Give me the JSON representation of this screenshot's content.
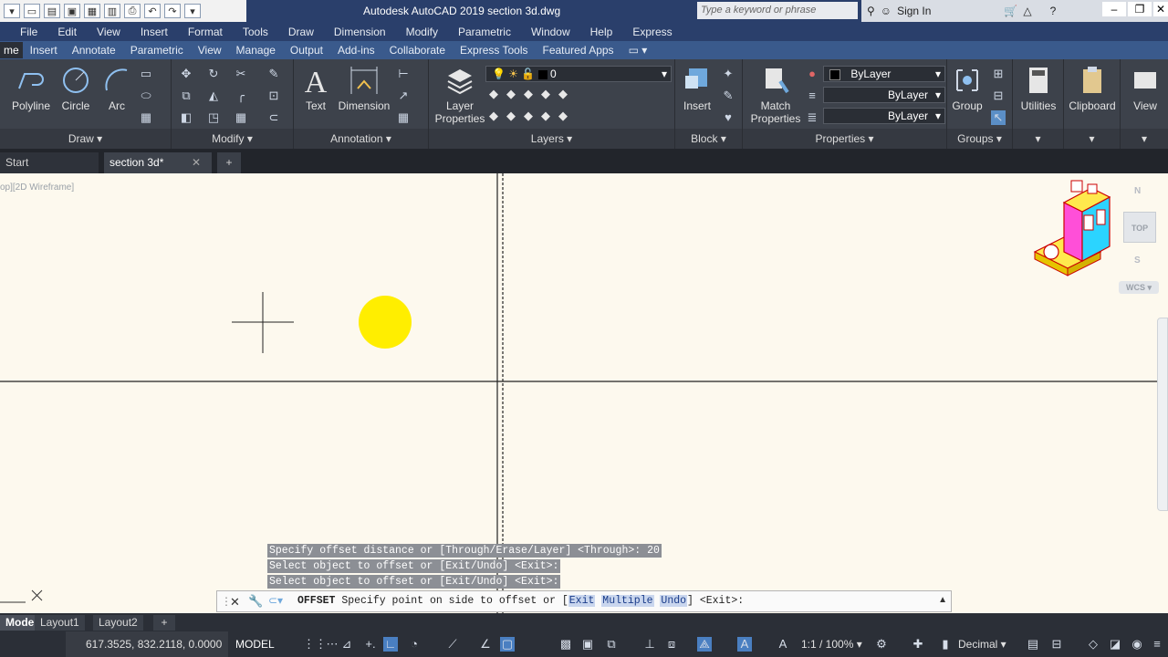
{
  "window": {
    "title": "Autodesk AutoCAD 2019    section 3d.dwg",
    "search_placeholder": "Type a keyword or phrase",
    "sign_in": "Sign In"
  },
  "menu": [
    "File",
    "Edit",
    "View",
    "Insert",
    "Format",
    "Tools",
    "Draw",
    "Dimension",
    "Modify",
    "Parametric",
    "Window",
    "Help",
    "Express"
  ],
  "ribbon_tabs": [
    "me",
    "Insert",
    "Annotate",
    "Parametric",
    "View",
    "Manage",
    "Output",
    "Add-ins",
    "Collaborate",
    "Express Tools",
    "Featured Apps"
  ],
  "ribbon": {
    "draw": {
      "title": "Draw",
      "polyline": "Polyline",
      "circle": "Circle",
      "arc": "Arc"
    },
    "modify": {
      "title": "Modify"
    },
    "annotation": {
      "title": "Annotation",
      "text": "Text",
      "dimension": "Dimension"
    },
    "layers": {
      "title": "Layers",
      "layer_properties_1": "Layer",
      "layer_properties_2": "Properties",
      "current_layer": "0"
    },
    "block": {
      "title": "Block",
      "insert": "Insert"
    },
    "properties": {
      "title": "Properties",
      "match_1": "Match",
      "match_2": "Properties",
      "color": "ByLayer",
      "linetype": "ByLayer",
      "lineweight": "ByLayer"
    },
    "groups": {
      "title": "Groups",
      "group": "Group"
    },
    "utilities": "Utilities",
    "clipboard": "Clipboard",
    "view": "View"
  },
  "file_tabs": {
    "start": "Start",
    "current": "section 3d*"
  },
  "viewport": {
    "label": "op][2D Wireframe]",
    "viewcube_top": "TOP",
    "viewcube_n": "N",
    "viewcube_s": "S",
    "wcs": "WCS"
  },
  "command": {
    "history": [
      "Specify offset distance or [Through/Erase/Layer] <Through>: 20",
      "Select object to offset or [Exit/Undo] <Exit>:",
      "Select object to offset or [Exit/Undo] <Exit>:"
    ],
    "name": "OFFSET",
    "prompt": "Specify point on side to offset or [",
    "options": [
      "Exit",
      "Multiple",
      "Undo"
    ],
    "suffix": "] <Exit>:"
  },
  "layout_tabs": [
    "Model",
    "Layout1",
    "Layout2"
  ],
  "status": {
    "coordinates": "617.3525, 832.2118, 0.0000",
    "model": "MODEL",
    "scale": "1:1 / 100%",
    "units": "Decimal"
  },
  "colors": {
    "canvas_bg": "#fdf9ee",
    "title_bar": "#2a3f6b",
    "ribbon_bg": "#3d424b",
    "circle_fill": "#ffee00"
  }
}
